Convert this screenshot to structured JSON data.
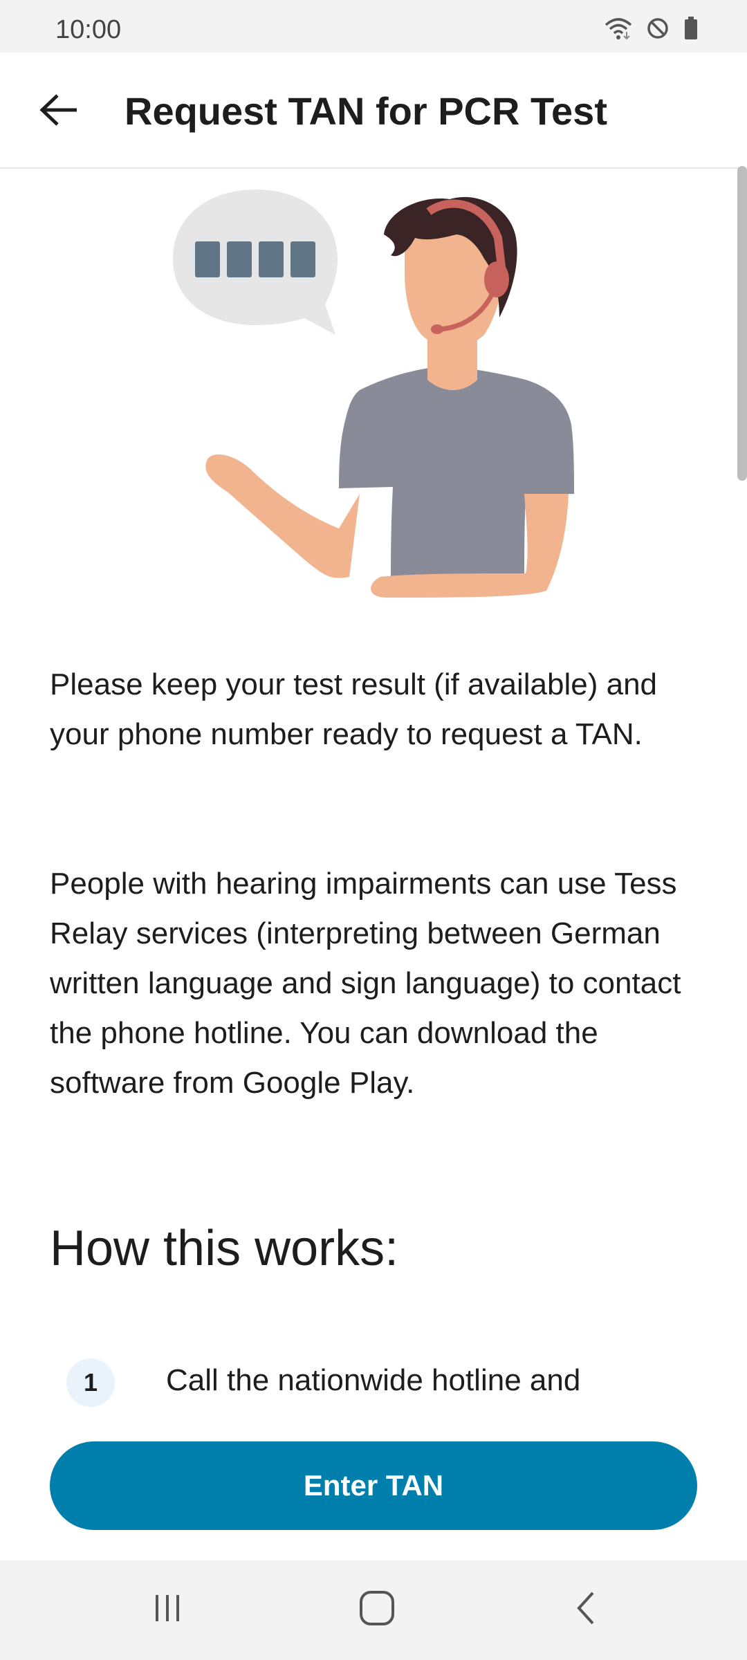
{
  "status_bar": {
    "time": "10:00",
    "icons": [
      "wifi-icon",
      "do-not-disturb-icon",
      "battery-icon"
    ]
  },
  "app_bar": {
    "title": "Request TAN for PCR Test",
    "back_icon": "arrow-left-icon"
  },
  "illustration": {
    "description_icon": "hotline-agent-illustration",
    "bubble_icon": "pin-code-speech-bubble-icon"
  },
  "content": {
    "paragraph_1": "Please keep your test result (if available) and your phone number ready to request a TAN.",
    "paragraph_2": "People with hearing impairments can use Tess Relay services (interpreting between German written language and sign language) to contact the phone hotline. You can download the software from Google Play.",
    "heading": "How this works:",
    "steps": [
      {
        "number": "1",
        "text": "Call the nationwide hotline and"
      }
    ]
  },
  "actions": {
    "primary_label": "Enter TAN"
  },
  "nav_bar": {
    "icons": [
      "recent-apps-icon",
      "home-icon",
      "back-icon"
    ]
  },
  "colors": {
    "primary": "#007fad",
    "step_badge_bg": "#e8f3fb",
    "text": "#1d1d1d",
    "shirt": "#8a8b98",
    "skin": "#f2b48f",
    "hair": "#3b2426",
    "headset": "#c8625c",
    "bubble": "#e6e6e6",
    "bubble_dots": "#607585"
  }
}
